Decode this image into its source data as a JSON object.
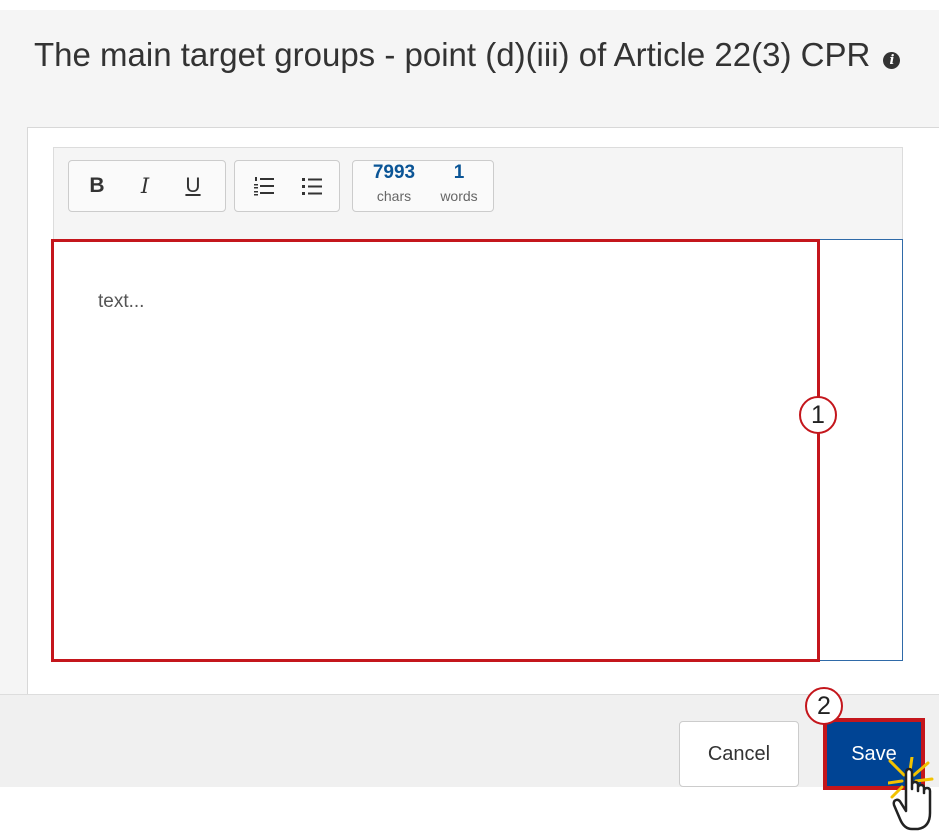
{
  "section": {
    "title": "The main target groups - point (d)(iii) of Article 22(3) CPR"
  },
  "toolbar": {
    "bold": "B",
    "italic": "I",
    "underline": "U"
  },
  "counter": {
    "chars_value": "7993",
    "chars_label": "chars",
    "words_value": "1",
    "words_label": "words"
  },
  "editor": {
    "placeholder": "text..."
  },
  "callouts": {
    "one": "1",
    "two": "2"
  },
  "footer": {
    "cancel_label": "Cancel",
    "save_label": "Save"
  },
  "icons": {
    "info": "info-icon",
    "ordered_list": "ordered-list-icon",
    "bullet_list": "bullet-list-icon",
    "cursor": "hand-pointer-icon"
  },
  "colors": {
    "highlight": "#c4161c",
    "save_button": "#004494",
    "counter_text": "#0b5596",
    "editor_border": "#2f6aa8"
  }
}
